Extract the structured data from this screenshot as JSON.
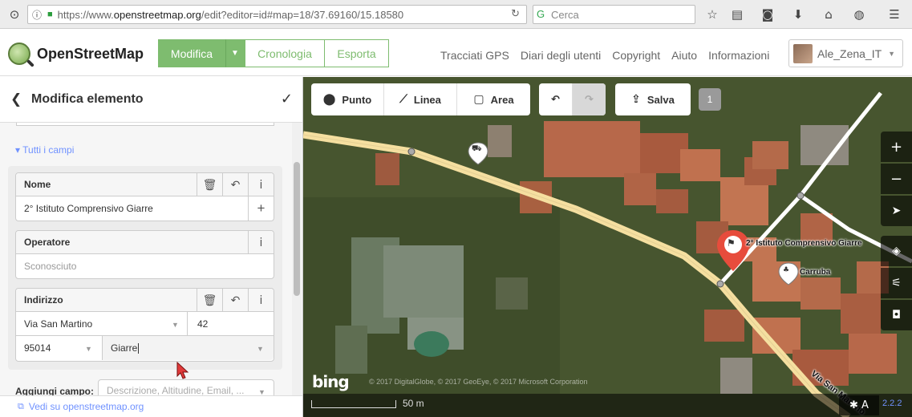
{
  "browser": {
    "url_prefix": "https://www.",
    "url_domain": "openstreetmap.org",
    "url_path": "/edit?editor=id#map=18/37.69160/15.18580",
    "search_placeholder": "Cerca"
  },
  "header": {
    "logo_text": "OpenStreetMap",
    "buttons": {
      "modifica": "Modifica",
      "cronologia": "Cronologia",
      "esporta": "Esporta"
    },
    "nav": [
      "Tracciati GPS",
      "Diari degli utenti",
      "Copyright",
      "Aiuto",
      "Informazioni"
    ],
    "username": "Ale_Zena_IT"
  },
  "sidebar": {
    "title": "Modifica elemento",
    "section_toggle": "Tutti i campi",
    "fields": {
      "nome": {
        "label": "Nome",
        "value": "2° Istituto Comprensivo Giarre"
      },
      "operatore": {
        "label": "Operatore",
        "placeholder": "Sconosciuto"
      },
      "indirizzo": {
        "label": "Indirizzo",
        "street": "Via San Martino",
        "housenumber": "42",
        "postcode": "95014",
        "city": "Giarre"
      }
    },
    "add_field_label": "Aggiungi campo:",
    "add_field_placeholder": "Descrizione, Altitudine, Email, ...",
    "footer_link": "Vedi su openstreetmap.org"
  },
  "map": {
    "toolbar": {
      "punto": "Punto",
      "linea": "Linea",
      "area": "Area",
      "salva": "Salva",
      "count": "1"
    },
    "labels": {
      "school": "2° Istituto Comprensivo Giarre",
      "carruba": "Carruba",
      "street": "Via San Martino"
    },
    "attribution": "© 2017 DigitalGlobe, © 2017 GeoEye, © 2017 Microsoft Corporation",
    "bing": "bing",
    "scale": "50 m",
    "version": "2.2.2"
  },
  "colors": {
    "osm_green": "#7ebc6f",
    "link_blue": "#7092ff",
    "selected_red": "#e74c3c",
    "road_yellow": "#f5dfa0"
  }
}
